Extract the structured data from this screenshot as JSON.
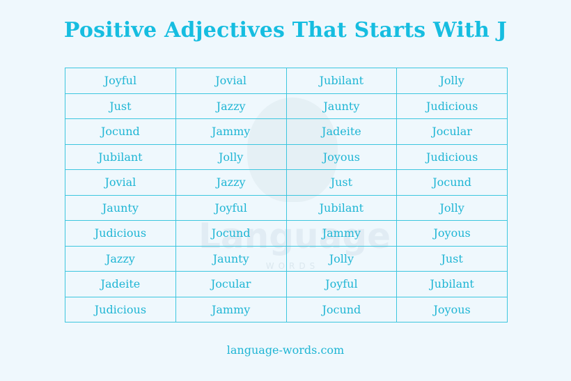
{
  "title": "Positive Adjectives That Starts With J",
  "watermark": {
    "text": "Language",
    "subtext": "WORDS"
  },
  "table": {
    "rows": [
      [
        "Joyful",
        "Jovial",
        "Jubilant",
        "Jolly"
      ],
      [
        "Just",
        "Jazzy",
        "Jaunty",
        "Judicious"
      ],
      [
        "Jocund",
        "Jammy",
        "Jadeite",
        "Jocular"
      ],
      [
        "Jubilant",
        "Jolly",
        "Joyous",
        "Judicious"
      ],
      [
        "Jovial",
        "Jazzy",
        "Just",
        "Jocund"
      ],
      [
        "Jaunty",
        "Joyful",
        "Jubilant",
        "Jolly"
      ],
      [
        "Judicious",
        "Jocund",
        "Jammy",
        "Joyous"
      ],
      [
        "Jazzy",
        "Jaunty",
        "Jolly",
        "Just"
      ],
      [
        "Jadeite",
        "Jocular",
        "Joyful",
        "Jubilant"
      ],
      [
        "Judicious",
        "Jammy",
        "Jocund",
        "Joyous"
      ]
    ]
  },
  "footer": "language-words.com",
  "colors": {
    "accent": "#16bde0",
    "border": "#3cc6df",
    "background": "#eff8fd"
  }
}
